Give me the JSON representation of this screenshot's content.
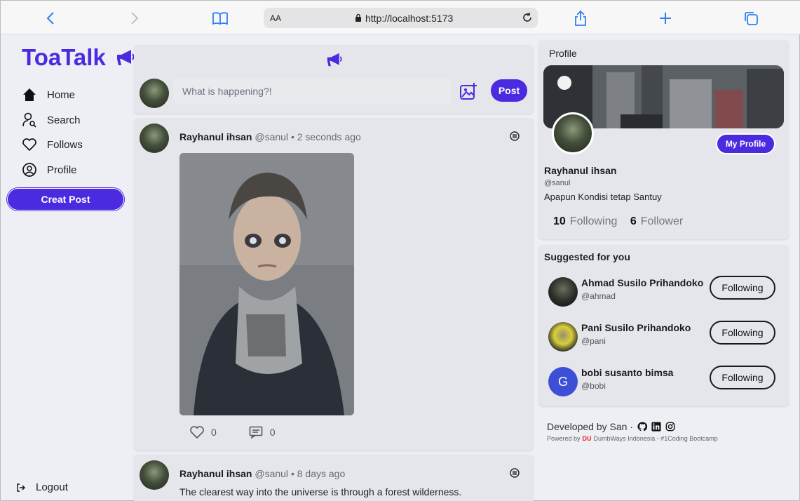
{
  "browser": {
    "text_size_label": "AA",
    "url": "http://localhost:5173"
  },
  "app": {
    "name": "ToaTalk",
    "accent_color": "#4c2ae0"
  },
  "sidebar": {
    "items": [
      {
        "label": "Home",
        "icon": "home-icon"
      },
      {
        "label": "Search",
        "icon": "search-user-icon"
      },
      {
        "label": "Follows",
        "icon": "heart-icon"
      },
      {
        "label": "Profile",
        "icon": "user-circle-icon"
      }
    ],
    "create_post_label": "Creat Post",
    "logout_label": "Logout"
  },
  "composer": {
    "placeholder": "What is happening?!",
    "post_label": "Post"
  },
  "posts": [
    {
      "author_name": "Rayhanul ihsan",
      "author_handle": "@sanul",
      "separator": "•",
      "time": "2 seconds ago",
      "likes": "0",
      "replies": "0"
    },
    {
      "author_name": "Rayhanul ihsan",
      "author_handle": "@sanul",
      "separator": "•",
      "time": "8 days ago",
      "text": "The clearest way into the universe is through a forest wilderness."
    }
  ],
  "profile": {
    "title": "Profile",
    "my_profile_label": "My Profile",
    "name": "Rayhanul ihsan",
    "handle": "@sanul",
    "bio": "Apapun Kondisi tetap Santuy",
    "following_count": "10",
    "following_label": "Following",
    "follower_count": "6",
    "follower_label": "Follower"
  },
  "suggestions": {
    "title": "Suggested for you",
    "users": [
      {
        "name": "Ahmad Susilo Prihandoko",
        "handle": "@ahmad",
        "button": "Following"
      },
      {
        "name": "Pani Susilo Prihandoko",
        "handle": "@pani",
        "button": "Following"
      },
      {
        "name": "bobi susanto bimsa",
        "handle": "@bobi",
        "button": "Following",
        "initial": "G"
      }
    ]
  },
  "footer": {
    "developed_by": "Developed by San ·",
    "powered_prefix": "Powered by",
    "dw_logo": "DU",
    "powered_suffix": "DumbWays Indonesia - #1Coding Bootcamp"
  }
}
